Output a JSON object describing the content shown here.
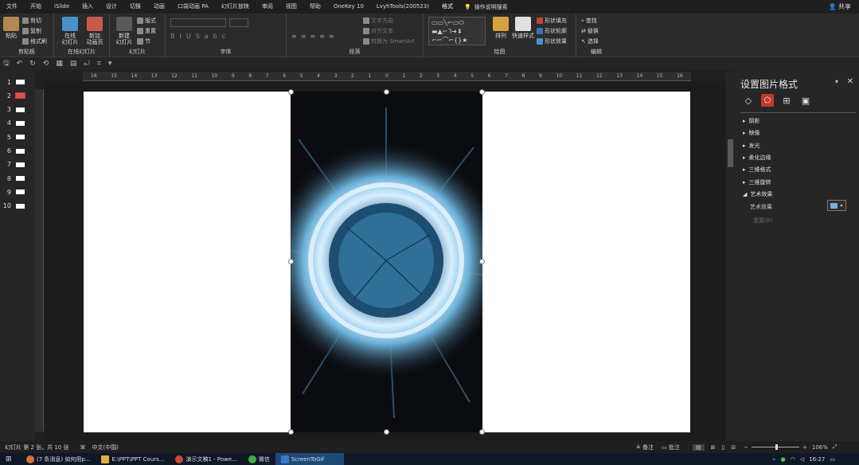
{
  "tabs": [
    "文件",
    "开始",
    "iSlide",
    "插入",
    "设计",
    "切换",
    "动画",
    "口袋动画 PA",
    "幻灯片放映",
    "审阅",
    "视图",
    "帮助",
    "OneKey 10",
    "LvyhTools(200523)",
    "格式"
  ],
  "tell_me": "操作说明搜索",
  "share": "共享",
  "ribbon": {
    "clipboard": {
      "label": "剪贴板",
      "paste": "粘贴",
      "cut": "剪切",
      "copy": "复制",
      "format_painter": "格式刷"
    },
    "online": {
      "label": "在线幻灯片",
      "online_slides": "在线\n幻灯片",
      "new_animation": "新加\n动画页"
    },
    "slides": {
      "label": "幻灯片",
      "new_slide": "新建\n幻灯片",
      "layout": "版式",
      "reset": "重置",
      "section": "节"
    },
    "font": {
      "label": "字体"
    },
    "paragraph": {
      "label": "段落",
      "text_direction": "文字方向",
      "align_text": "对齐文本",
      "smartart": "转换为 SmartArt"
    },
    "drawing": {
      "label": "绘图",
      "arrange": "排列",
      "quick_styles": "快速样式",
      "shape_fill": "形状填充",
      "shape_outline": "形状轮廓",
      "shape_effects": "形状效果"
    },
    "editing": {
      "label": "编辑",
      "find": "查找",
      "replace": "替换",
      "select": "选择"
    }
  },
  "thumbnails": [
    1,
    2,
    3,
    4,
    5,
    6,
    7,
    8,
    9,
    10
  ],
  "selected_thumbnail": 2,
  "ruler_ticks": [
    "16",
    "15",
    "14",
    "13",
    "12",
    "11",
    "10",
    "9",
    "8",
    "7",
    "6",
    "5",
    "4",
    "3",
    "2",
    "1",
    "0",
    "1",
    "2",
    "3",
    "4",
    "5",
    "6",
    "7",
    "8",
    "9",
    "10",
    "11",
    "12",
    "13",
    "14",
    "15",
    "16"
  ],
  "pane": {
    "title": "设置图片格式",
    "sections": [
      "阴影",
      "映像",
      "发光",
      "柔化边缘",
      "三维格式",
      "三维旋转",
      "艺术效果"
    ],
    "expanded_label": "艺术效果",
    "reset": "重置(R)"
  },
  "status": {
    "slide_info": "幻灯片 第 2 张，共 10 张",
    "language": "中文(中国)",
    "notes": "备注",
    "comments": "批注",
    "zoom": "106%"
  },
  "taskbar": {
    "items": [
      "(7 条消息) 如何用p...",
      "E:\\PPT\\PPT Cours...",
      "演示文稿1 - Powe...",
      "微信",
      "ScreenToGif"
    ],
    "time": "16:27"
  },
  "colors": {
    "accent": "#c0392b",
    "taskbar_active": "#1e4a78"
  }
}
